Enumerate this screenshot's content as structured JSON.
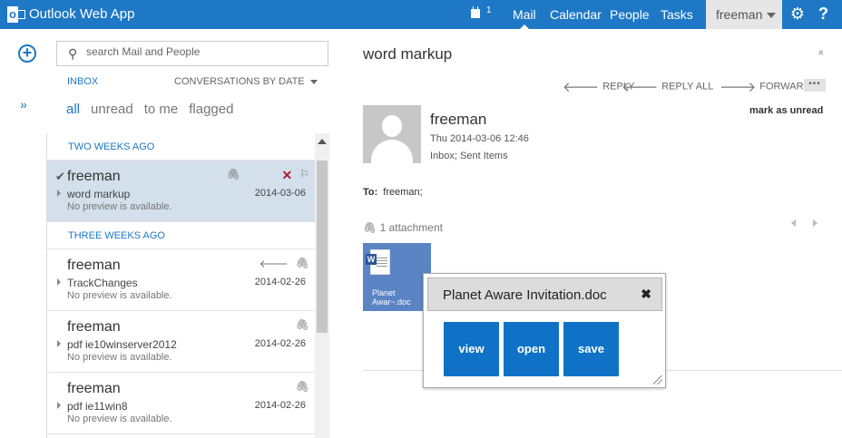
{
  "app": {
    "title": "Outlook Web App"
  },
  "header": {
    "calendar_count": "1",
    "nav": [
      "Mail",
      "Calendar",
      "People",
      "Tasks"
    ],
    "user": "freeman",
    "settings_icon": "gear-icon",
    "help_label": "?",
    "accent_color": "#1e78c6"
  },
  "leftcol": {
    "new_icon": "+",
    "expand_icon": "»"
  },
  "search": {
    "placeholder": "search Mail and People"
  },
  "list": {
    "folder": "INBOX",
    "sort": "CONVERSATIONS BY DATE",
    "filters": [
      "all",
      "unread",
      "to me",
      "flagged"
    ],
    "groups": [
      {
        "label": "TWO WEEKS AGO",
        "items": [
          {
            "from": "freeman",
            "subject": "word markup",
            "preview": "No preview is available.",
            "date": "2014-03-06"
          }
        ]
      },
      {
        "label": "THREE WEEKS AGO",
        "items": [
          {
            "from": "freeman",
            "subject": "TrackChanges",
            "preview": "No preview is available.",
            "date": "2014-02-26"
          },
          {
            "from": "freeman",
            "subject": "pdf ie10winserver2012",
            "preview": "No preview is available.",
            "date": "2014-02-26"
          },
          {
            "from": "freeman",
            "subject": "pdf ie11win8",
            "preview": "No preview is available.",
            "date": "2014-02-26"
          }
        ]
      }
    ]
  },
  "reading": {
    "subject": "word markup",
    "collapse_icon": "»",
    "actions": {
      "reply": "REPLY",
      "reply_all": "REPLY ALL",
      "forward": "FORWARD",
      "more": "•••"
    },
    "from": "freeman",
    "date": "Thu 2014-03-06 12:46",
    "folders": "Inbox; Sent Items",
    "mark_unread": "mark as unread",
    "to_label": "To:",
    "to_value": "freeman;",
    "attachments_label": "1 attachment",
    "attachment": {
      "name": "Planet Awar~.doc",
      "name_line1": "Planet",
      "name_line2": "Awar~.doc",
      "badge": "W"
    }
  },
  "popup": {
    "title": "Planet Aware Invitation.doc",
    "close": "✖",
    "buttons": {
      "view": "view",
      "open": "open",
      "save": "save"
    }
  }
}
